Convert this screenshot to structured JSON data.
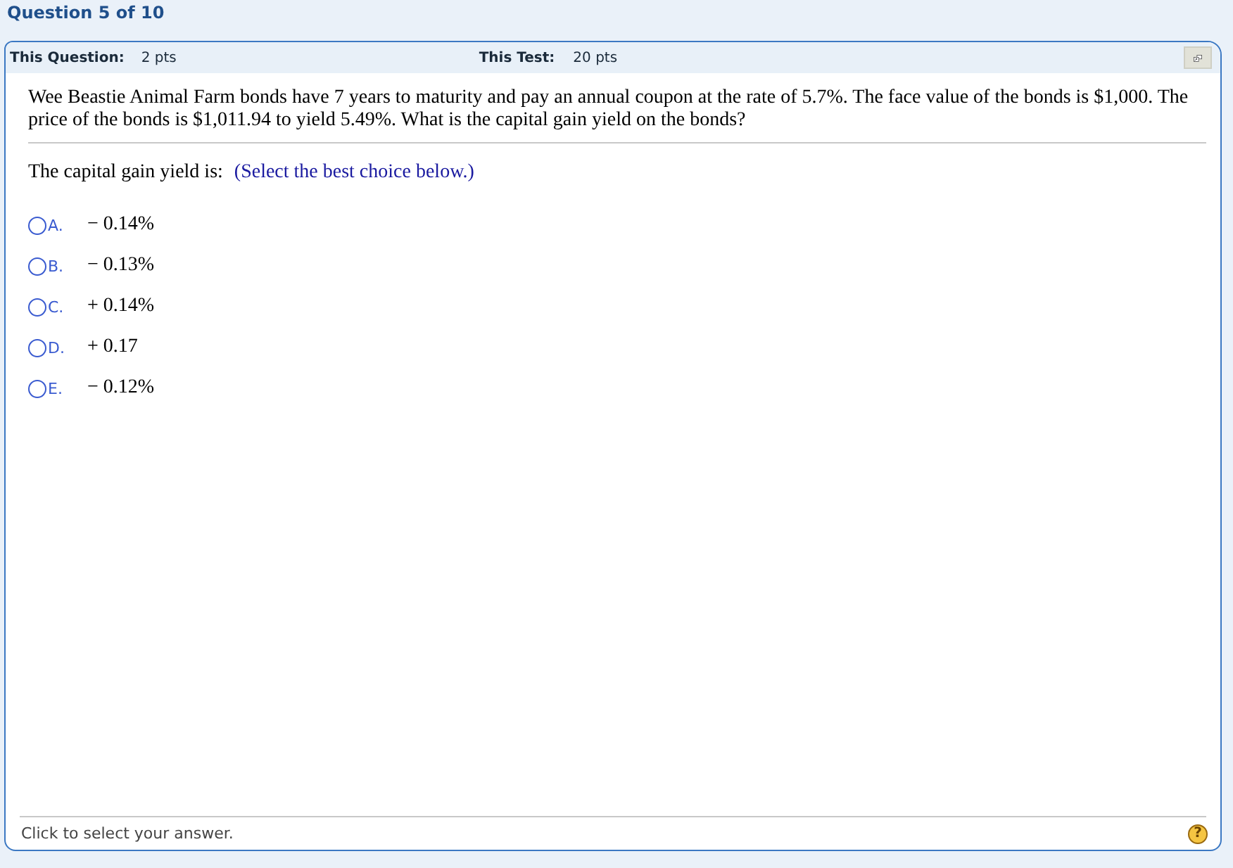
{
  "header": {
    "title": "Question 5 of 10"
  },
  "points": {
    "question_label": "This Question:",
    "question_value": "2 pts",
    "test_label": "This Test:",
    "test_value": "20 pts"
  },
  "question": {
    "text": "Wee Beastie Animal Farm bonds have 7 years to maturity and pay an annual coupon at the rate of 5.7%. The face value of the bonds is $1,000. The price of the bonds is $1,011.94 to yield 5.49%. What is the capital gain yield on the bonds?",
    "prompt": "The capital gain yield is:",
    "instruction": "(Select the best choice below.)"
  },
  "choices": [
    {
      "letter": "A.",
      "text": "− 0.14%",
      "selected": false
    },
    {
      "letter": "B.",
      "text": "− 0.13%",
      "selected": false
    },
    {
      "letter": "C.",
      "text": "+ 0.14%",
      "selected": false
    },
    {
      "letter": "D.",
      "text": "+ 0.17",
      "selected": false
    },
    {
      "letter": "E.",
      "text": "− 0.12%",
      "selected": false
    }
  ],
  "status": {
    "text": "Click to select your answer.",
    "help": "?"
  }
}
